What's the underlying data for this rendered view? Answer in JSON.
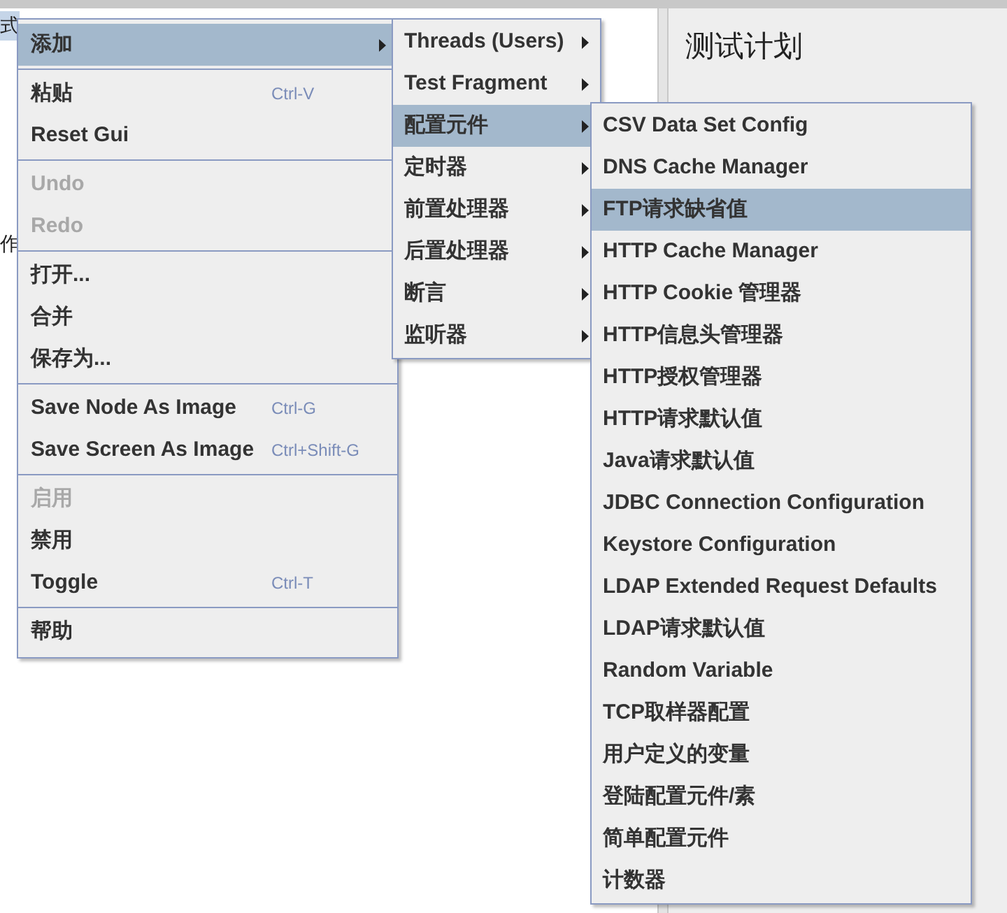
{
  "tree_fragments": [
    "式",
    "作"
  ],
  "right_panel": {
    "title": "测试计划"
  },
  "context_menu": {
    "groups": [
      {
        "items": [
          {
            "label": "添加",
            "selected": true,
            "disabled": false,
            "has_submenu": true
          }
        ]
      },
      {
        "items": [
          {
            "label": "粘贴",
            "shortcut": "Ctrl-V",
            "selected": false,
            "disabled": false,
            "has_submenu": false
          },
          {
            "label": "Reset Gui",
            "selected": false,
            "disabled": false,
            "has_submenu": false
          }
        ]
      },
      {
        "items": [
          {
            "label": "Undo",
            "selected": false,
            "disabled": true,
            "has_submenu": false
          },
          {
            "label": "Redo",
            "selected": false,
            "disabled": true,
            "has_submenu": false
          }
        ]
      },
      {
        "items": [
          {
            "label": "打开...",
            "selected": false,
            "disabled": false,
            "has_submenu": false
          },
          {
            "label": "合并",
            "selected": false,
            "disabled": false,
            "has_submenu": false
          },
          {
            "label": "保存为...",
            "selected": false,
            "disabled": false,
            "has_submenu": false
          }
        ]
      },
      {
        "items": [
          {
            "label": "Save Node As Image",
            "shortcut": "Ctrl-G",
            "selected": false,
            "disabled": false,
            "has_submenu": false
          },
          {
            "label": "Save Screen As Image",
            "shortcut": "Ctrl+Shift-G",
            "selected": false,
            "disabled": false,
            "has_submenu": false
          }
        ]
      },
      {
        "items": [
          {
            "label": "启用",
            "selected": false,
            "disabled": true,
            "has_submenu": false
          },
          {
            "label": "禁用",
            "selected": false,
            "disabled": false,
            "has_submenu": false
          },
          {
            "label": "Toggle",
            "shortcut": "Ctrl-T",
            "selected": false,
            "disabled": false,
            "has_submenu": false
          }
        ]
      },
      {
        "items": [
          {
            "label": "帮助",
            "selected": false,
            "disabled": false,
            "has_submenu": false
          }
        ]
      }
    ]
  },
  "add_submenu": {
    "items": [
      {
        "label": "Threads (Users)",
        "selected": false,
        "has_submenu": true
      },
      {
        "label": "Test Fragment",
        "selected": false,
        "has_submenu": true
      },
      {
        "label": "配置元件",
        "selected": true,
        "has_submenu": true
      },
      {
        "label": "定时器",
        "selected": false,
        "has_submenu": true
      },
      {
        "label": "前置处理器",
        "selected": false,
        "has_submenu": true
      },
      {
        "label": "后置处理器",
        "selected": false,
        "has_submenu": true
      },
      {
        "label": "断言",
        "selected": false,
        "has_submenu": true
      },
      {
        "label": "监听器",
        "selected": false,
        "has_submenu": true
      }
    ]
  },
  "config_submenu": {
    "items": [
      {
        "label": "CSV Data Set Config",
        "selected": false
      },
      {
        "label": "DNS Cache Manager",
        "selected": false
      },
      {
        "label": "FTP请求缺省值",
        "selected": true
      },
      {
        "label": "HTTP Cache Manager",
        "selected": false
      },
      {
        "label": "HTTP Cookie 管理器",
        "selected": false
      },
      {
        "label": "HTTP信息头管理器",
        "selected": false
      },
      {
        "label": "HTTP授权管理器",
        "selected": false
      },
      {
        "label": "HTTP请求默认值",
        "selected": false
      },
      {
        "label": "Java请求默认值",
        "selected": false
      },
      {
        "label": "JDBC Connection Configuration",
        "selected": false
      },
      {
        "label": "Keystore Configuration",
        "selected": false
      },
      {
        "label": "LDAP Extended Request Defaults",
        "selected": false
      },
      {
        "label": "LDAP请求默认值",
        "selected": false
      },
      {
        "label": "Random Variable",
        "selected": false
      },
      {
        "label": "TCP取样器配置",
        "selected": false
      },
      {
        "label": "用户定义的变量",
        "selected": false
      },
      {
        "label": "登陆配置元件/素",
        "selected": false
      },
      {
        "label": "简单配置元件",
        "selected": false
      },
      {
        "label": "计数器",
        "selected": false
      }
    ]
  }
}
